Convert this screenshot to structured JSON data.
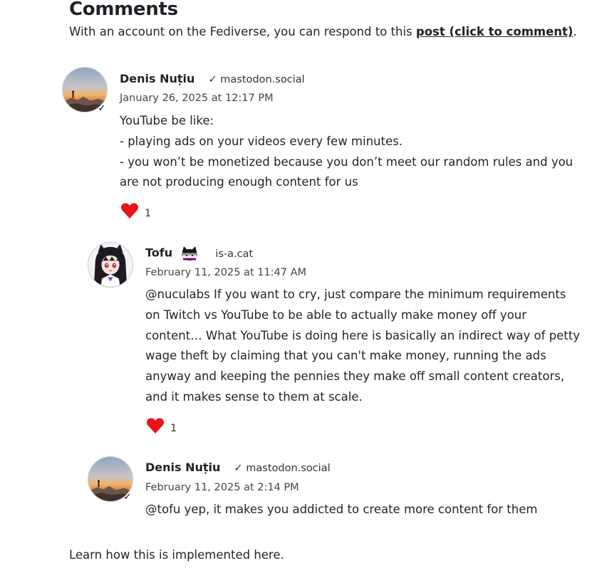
{
  "section": {
    "title": "Comments",
    "intro_prefix": "With an account on the Fediverse, you can respond to this ",
    "intro_link": "post (click to comment)",
    "intro_suffix": "."
  },
  "comments": [
    {
      "author": "Denis Nuțiu",
      "verified_mark": "✓",
      "instance": "mastodon.social",
      "date": "January 26, 2025 at 12:17 PM",
      "lines": [
        "YouTube be like:",
        "- playing ads on your videos every few minutes.",
        "- you won’t be monetized because you don’t meet our random rules and you are not producing enough content for us"
      ],
      "likes": "1"
    },
    {
      "author": "Tofu",
      "instance": "is-a.cat",
      "date": "February 11, 2025 at 11:47 AM",
      "lines": [
        "@nuculabs If you want to cry, just compare the minimum requirements on Twitch vs YouTube to be able to actually make money off your content… What YouTube is doing here is basically an indirect way of petty wage theft by claiming that you can't make money, running the ads anyway and keeping the pennies they make off small content creators, and it makes sense to them at scale."
      ],
      "likes": "1"
    },
    {
      "author": "Denis Nuțiu",
      "verified_mark": "✓",
      "instance": "mastodon.social",
      "date": "February 11, 2025 at 2:14 PM",
      "lines": [
        "@tofu yep, it makes you addicted to create more content for them"
      ]
    }
  ],
  "footer": {
    "text": "Learn how this is implemented here."
  },
  "colors": {
    "heart": "#e8131b",
    "text": "#1f2328"
  },
  "icons": {
    "like": "heart-icon",
    "verified": "check-icon",
    "avatar_denis": "sunset-avatar",
    "avatar_tofu": "anime-cat-girl-avatar"
  }
}
